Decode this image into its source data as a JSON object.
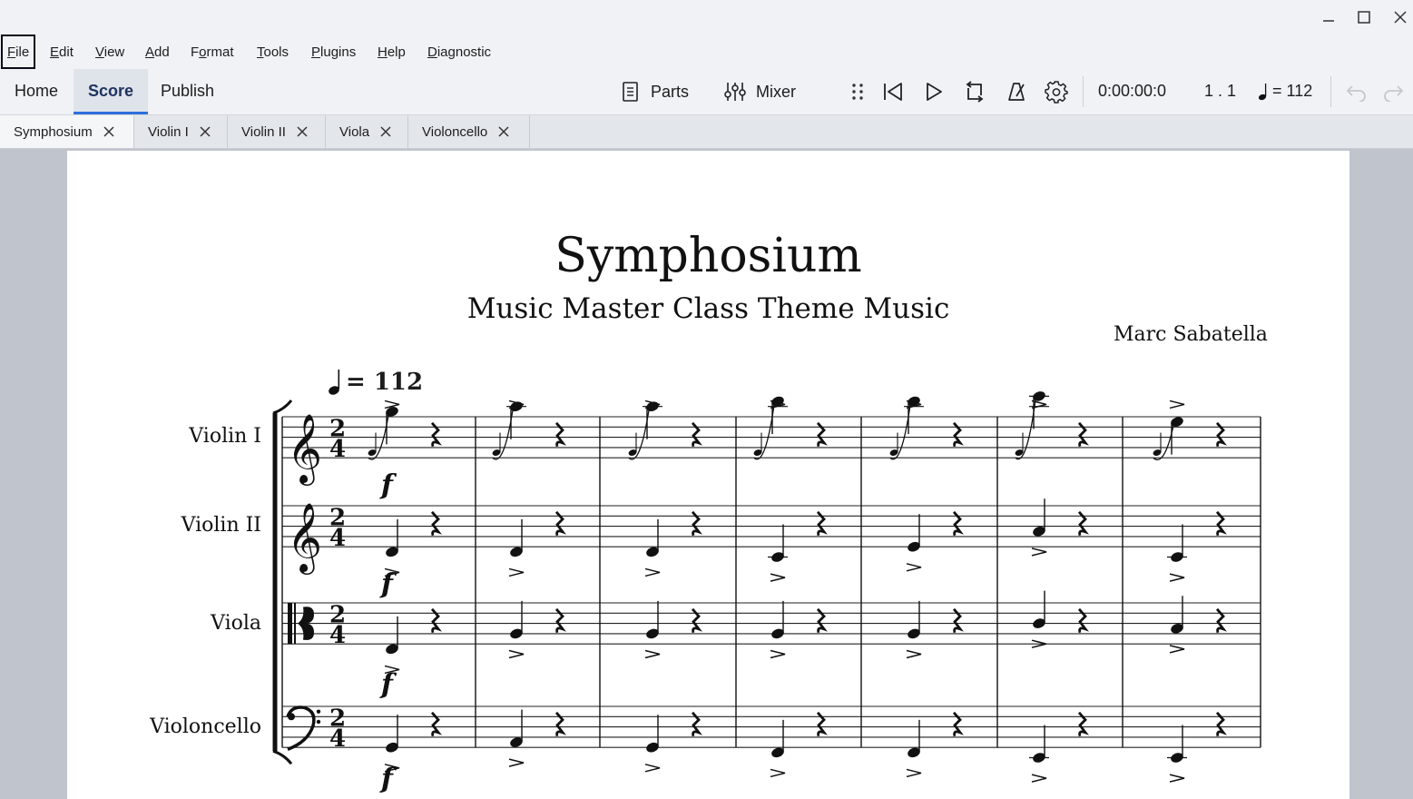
{
  "window": {
    "controls": [
      "minimize-icon",
      "maximize-icon",
      "close-icon"
    ]
  },
  "menu": {
    "items": [
      {
        "label": "File",
        "mnemonic": "F",
        "rest": "ile"
      },
      {
        "label": "Edit",
        "mnemonic": "E",
        "rest": "dit"
      },
      {
        "label": "View",
        "mnemonic": "V",
        "rest": "iew"
      },
      {
        "label": "Add",
        "mnemonic": "A",
        "rest": "dd"
      },
      {
        "label": "Format",
        "pre": "F",
        "mnemonic": "o",
        "rest": "rmat"
      },
      {
        "label": "Tools",
        "mnemonic": "T",
        "rest": "ools"
      },
      {
        "label": "Plugins",
        "mnemonic": "P",
        "rest": "lugins"
      },
      {
        "label": "Help",
        "mnemonic": "H",
        "rest": "elp"
      },
      {
        "label": "Diagnostic",
        "mnemonic": "D",
        "rest": "iagnostic"
      }
    ]
  },
  "toolbar": {
    "home": "Home",
    "score": "Score",
    "publish": "Publish",
    "parts": "Parts",
    "mixer": "Mixer",
    "time": "0:00:00:0",
    "position": "1 . 1",
    "tempo": "= 112"
  },
  "doc_tabs": [
    {
      "label": "Symphosium"
    },
    {
      "label": "Violin I"
    },
    {
      "label": "Violin II"
    },
    {
      "label": "Viola"
    },
    {
      "label": "Violoncello"
    }
  ],
  "score": {
    "title": "Symphosium",
    "subtitle": "Music Master Class Theme Music",
    "composer": "Marc Sabatella",
    "tempo_marking": "= 112",
    "time_signature": "2/4",
    "dynamic": "f",
    "instruments": [
      "Violin I",
      "Violin II",
      "Viola",
      "Violoncello"
    ]
  },
  "colors": {
    "accent": "#2e6fdc",
    "chrome": "#f0f2f5",
    "workspace": "#c0c4cc"
  }
}
